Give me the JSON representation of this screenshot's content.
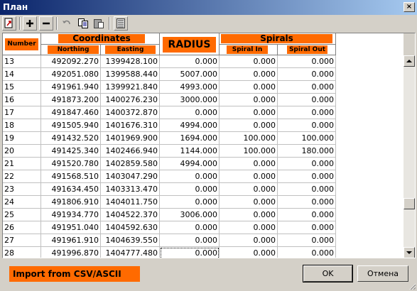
{
  "window": {
    "title": "План",
    "close_glyph": "×"
  },
  "toolbar": {
    "buttons": [
      {
        "name": "export-icon"
      },
      {
        "name": "add-row-icon",
        "glyph": "+"
      },
      {
        "name": "remove-row-icon",
        "glyph": "−"
      },
      {
        "name": "undo-icon"
      },
      {
        "name": "copy-icon"
      },
      {
        "name": "paste-icon"
      },
      {
        "name": "table-icon"
      }
    ]
  },
  "columns": {
    "number": "Number",
    "coordinates": "Coordinates",
    "northing": "Northing",
    "easting": "Easting",
    "radius": "RADIUS",
    "spirals": "Spirals",
    "spiral_in": "Spiral In",
    "spiral_out": "Spiral Out"
  },
  "rows": [
    [
      "13",
      "492092.270",
      "1399428.100",
      "0.000",
      "0.000",
      "0.000"
    ],
    [
      "14",
      "492051.080",
      "1399588.440",
      "5007.000",
      "0.000",
      "0.000"
    ],
    [
      "15",
      "491961.940",
      "1399921.840",
      "4993.000",
      "0.000",
      "0.000"
    ],
    [
      "16",
      "491873.200",
      "1400276.230",
      "3000.000",
      "0.000",
      "0.000"
    ],
    [
      "17",
      "491847.460",
      "1400372.870",
      "0.000",
      "0.000",
      "0.000"
    ],
    [
      "18",
      "491505.940",
      "1401676.310",
      "4994.000",
      "0.000",
      "0.000"
    ],
    [
      "19",
      "491432.520",
      "1401969.900",
      "1694.000",
      "100.000",
      "100.000"
    ],
    [
      "20",
      "491425.340",
      "1402466.940",
      "1144.000",
      "100.000",
      "180.000"
    ],
    [
      "21",
      "491520.780",
      "1402859.580",
      "4994.000",
      "0.000",
      "0.000"
    ],
    [
      "22",
      "491568.510",
      "1403047.290",
      "0.000",
      "0.000",
      "0.000"
    ],
    [
      "23",
      "491634.450",
      "1403313.470",
      "0.000",
      "0.000",
      "0.000"
    ],
    [
      "24",
      "491806.910",
      "1404011.750",
      "0.000",
      "0.000",
      "0.000"
    ],
    [
      "25",
      "491934.770",
      "1404522.370",
      "3006.000",
      "0.000",
      "0.000"
    ],
    [
      "26",
      "491951.040",
      "1404592.630",
      "0.000",
      "0.000",
      "0.000"
    ],
    [
      "27",
      "491961.910",
      "1404639.550",
      "0.000",
      "0.000",
      "0.000"
    ],
    [
      "28",
      "491996.870",
      "1404777.480",
      "0.000",
      "0.000",
      "0.000"
    ]
  ],
  "selected_cell": {
    "row": 15,
    "column": "radius"
  },
  "footer": {
    "import_label": "Import from CSV/ASCII",
    "ok_label": "OK",
    "cancel_label": "Отмена"
  },
  "colors": {
    "accent": "#ff6a00",
    "titlebar": "#0a246a",
    "face": "#d4d0c8"
  }
}
